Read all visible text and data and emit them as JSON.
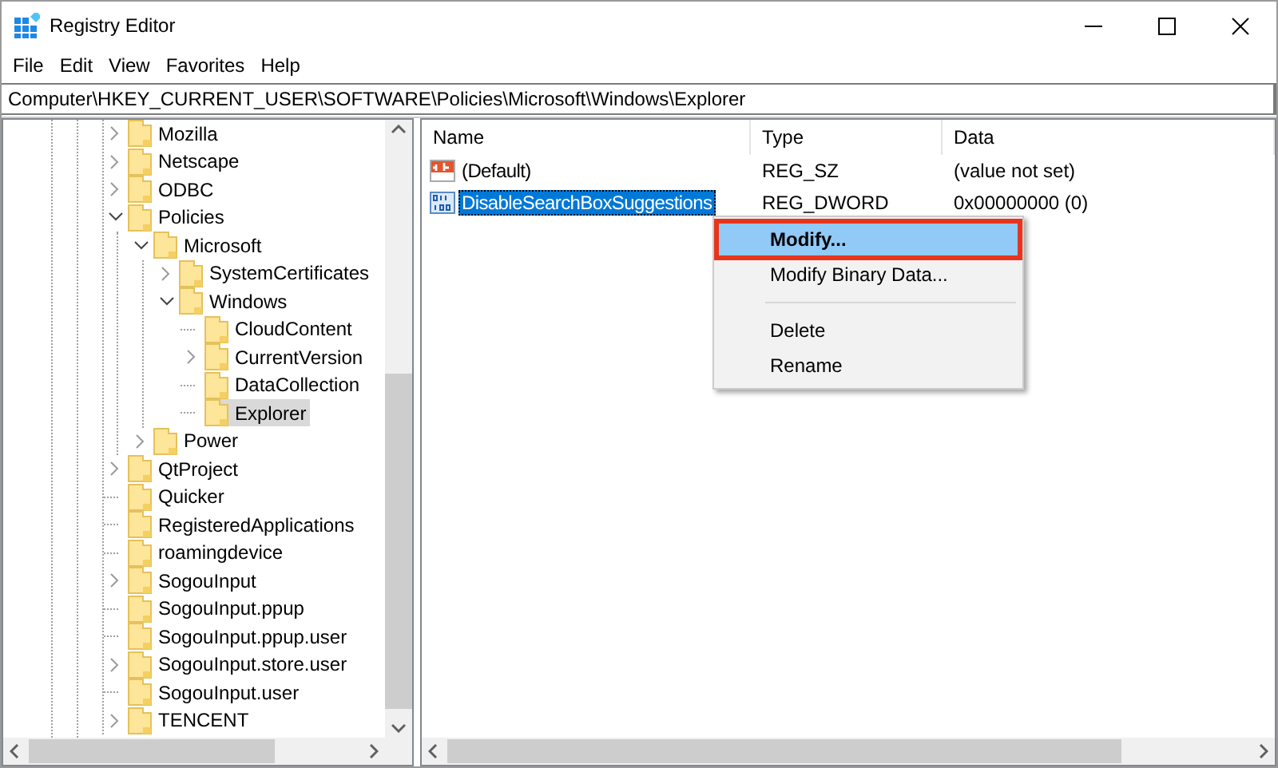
{
  "window": {
    "title": "Registry Editor"
  },
  "menu_bar": [
    "File",
    "Edit",
    "View",
    "Favorites",
    "Help"
  ],
  "address_bar": {
    "value": "Computer\\HKEY_CURRENT_USER\\SOFTWARE\\Policies\\Microsoft\\Windows\\Explorer"
  },
  "tree": {
    "items": [
      {
        "label": "Mozilla",
        "has_children": true,
        "expanded": false,
        "selected": false
      },
      {
        "label": "Netscape",
        "has_children": true,
        "expanded": false,
        "selected": false
      },
      {
        "label": "ODBC",
        "has_children": true,
        "expanded": false,
        "selected": false
      },
      {
        "label": "Policies",
        "has_children": true,
        "expanded": true,
        "selected": false,
        "children": [
          {
            "label": "Microsoft",
            "has_children": true,
            "expanded": true,
            "selected": false,
            "children": [
              {
                "label": "SystemCertificates",
                "has_children": true,
                "expanded": false,
                "selected": false
              },
              {
                "label": "Windows",
                "has_children": true,
                "expanded": true,
                "selected": false,
                "children": [
                  {
                    "label": "CloudContent",
                    "has_children": false,
                    "expanded": false,
                    "selected": false
                  },
                  {
                    "label": "CurrentVersion",
                    "has_children": true,
                    "expanded": false,
                    "selected": false
                  },
                  {
                    "label": "DataCollection",
                    "has_children": false,
                    "expanded": false,
                    "selected": false
                  },
                  {
                    "label": "Explorer",
                    "has_children": false,
                    "expanded": false,
                    "selected": true
                  }
                ]
              }
            ]
          },
          {
            "label": "Power",
            "has_children": true,
            "expanded": false,
            "selected": false
          }
        ]
      },
      {
        "label": "QtProject",
        "has_children": true,
        "expanded": false,
        "selected": false
      },
      {
        "label": "Quicker",
        "has_children": false,
        "expanded": false,
        "selected": false
      },
      {
        "label": "RegisteredApplications",
        "has_children": false,
        "expanded": false,
        "selected": false
      },
      {
        "label": "roamingdevice",
        "has_children": false,
        "expanded": false,
        "selected": false
      },
      {
        "label": "SogouInput",
        "has_children": true,
        "expanded": false,
        "selected": false
      },
      {
        "label": "SogouInput.ppup",
        "has_children": false,
        "expanded": false,
        "selected": false
      },
      {
        "label": "SogouInput.ppup.user",
        "has_children": false,
        "expanded": false,
        "selected": false
      },
      {
        "label": "SogouInput.store.user",
        "has_children": true,
        "expanded": false,
        "selected": false
      },
      {
        "label": "SogouInput.user",
        "has_children": false,
        "expanded": false,
        "selected": false
      },
      {
        "label": "TENCENT",
        "has_children": true,
        "expanded": false,
        "selected": false
      }
    ]
  },
  "values": {
    "columns": [
      "Name",
      "Type",
      "Data"
    ],
    "rows": [
      {
        "kind": "string",
        "name": "(Default)",
        "type": "REG_SZ",
        "data": "(value not set)",
        "selected": false
      },
      {
        "kind": "binary",
        "name": "DisableSearchBoxSuggestions",
        "type": "REG_DWORD",
        "data": "0x00000000 (0)",
        "selected": true
      }
    ]
  },
  "context_menu": {
    "items": [
      {
        "kind": "item",
        "label": "Modify...",
        "default": true,
        "selected": true,
        "outlined": true
      },
      {
        "kind": "item",
        "label": "Modify Binary Data...",
        "default": false,
        "selected": false,
        "outlined": false
      },
      {
        "kind": "separator"
      },
      {
        "kind": "item",
        "label": "Delete",
        "default": false,
        "selected": false,
        "outlined": false
      },
      {
        "kind": "item",
        "label": "Rename",
        "default": false,
        "selected": false,
        "outlined": false
      }
    ]
  }
}
